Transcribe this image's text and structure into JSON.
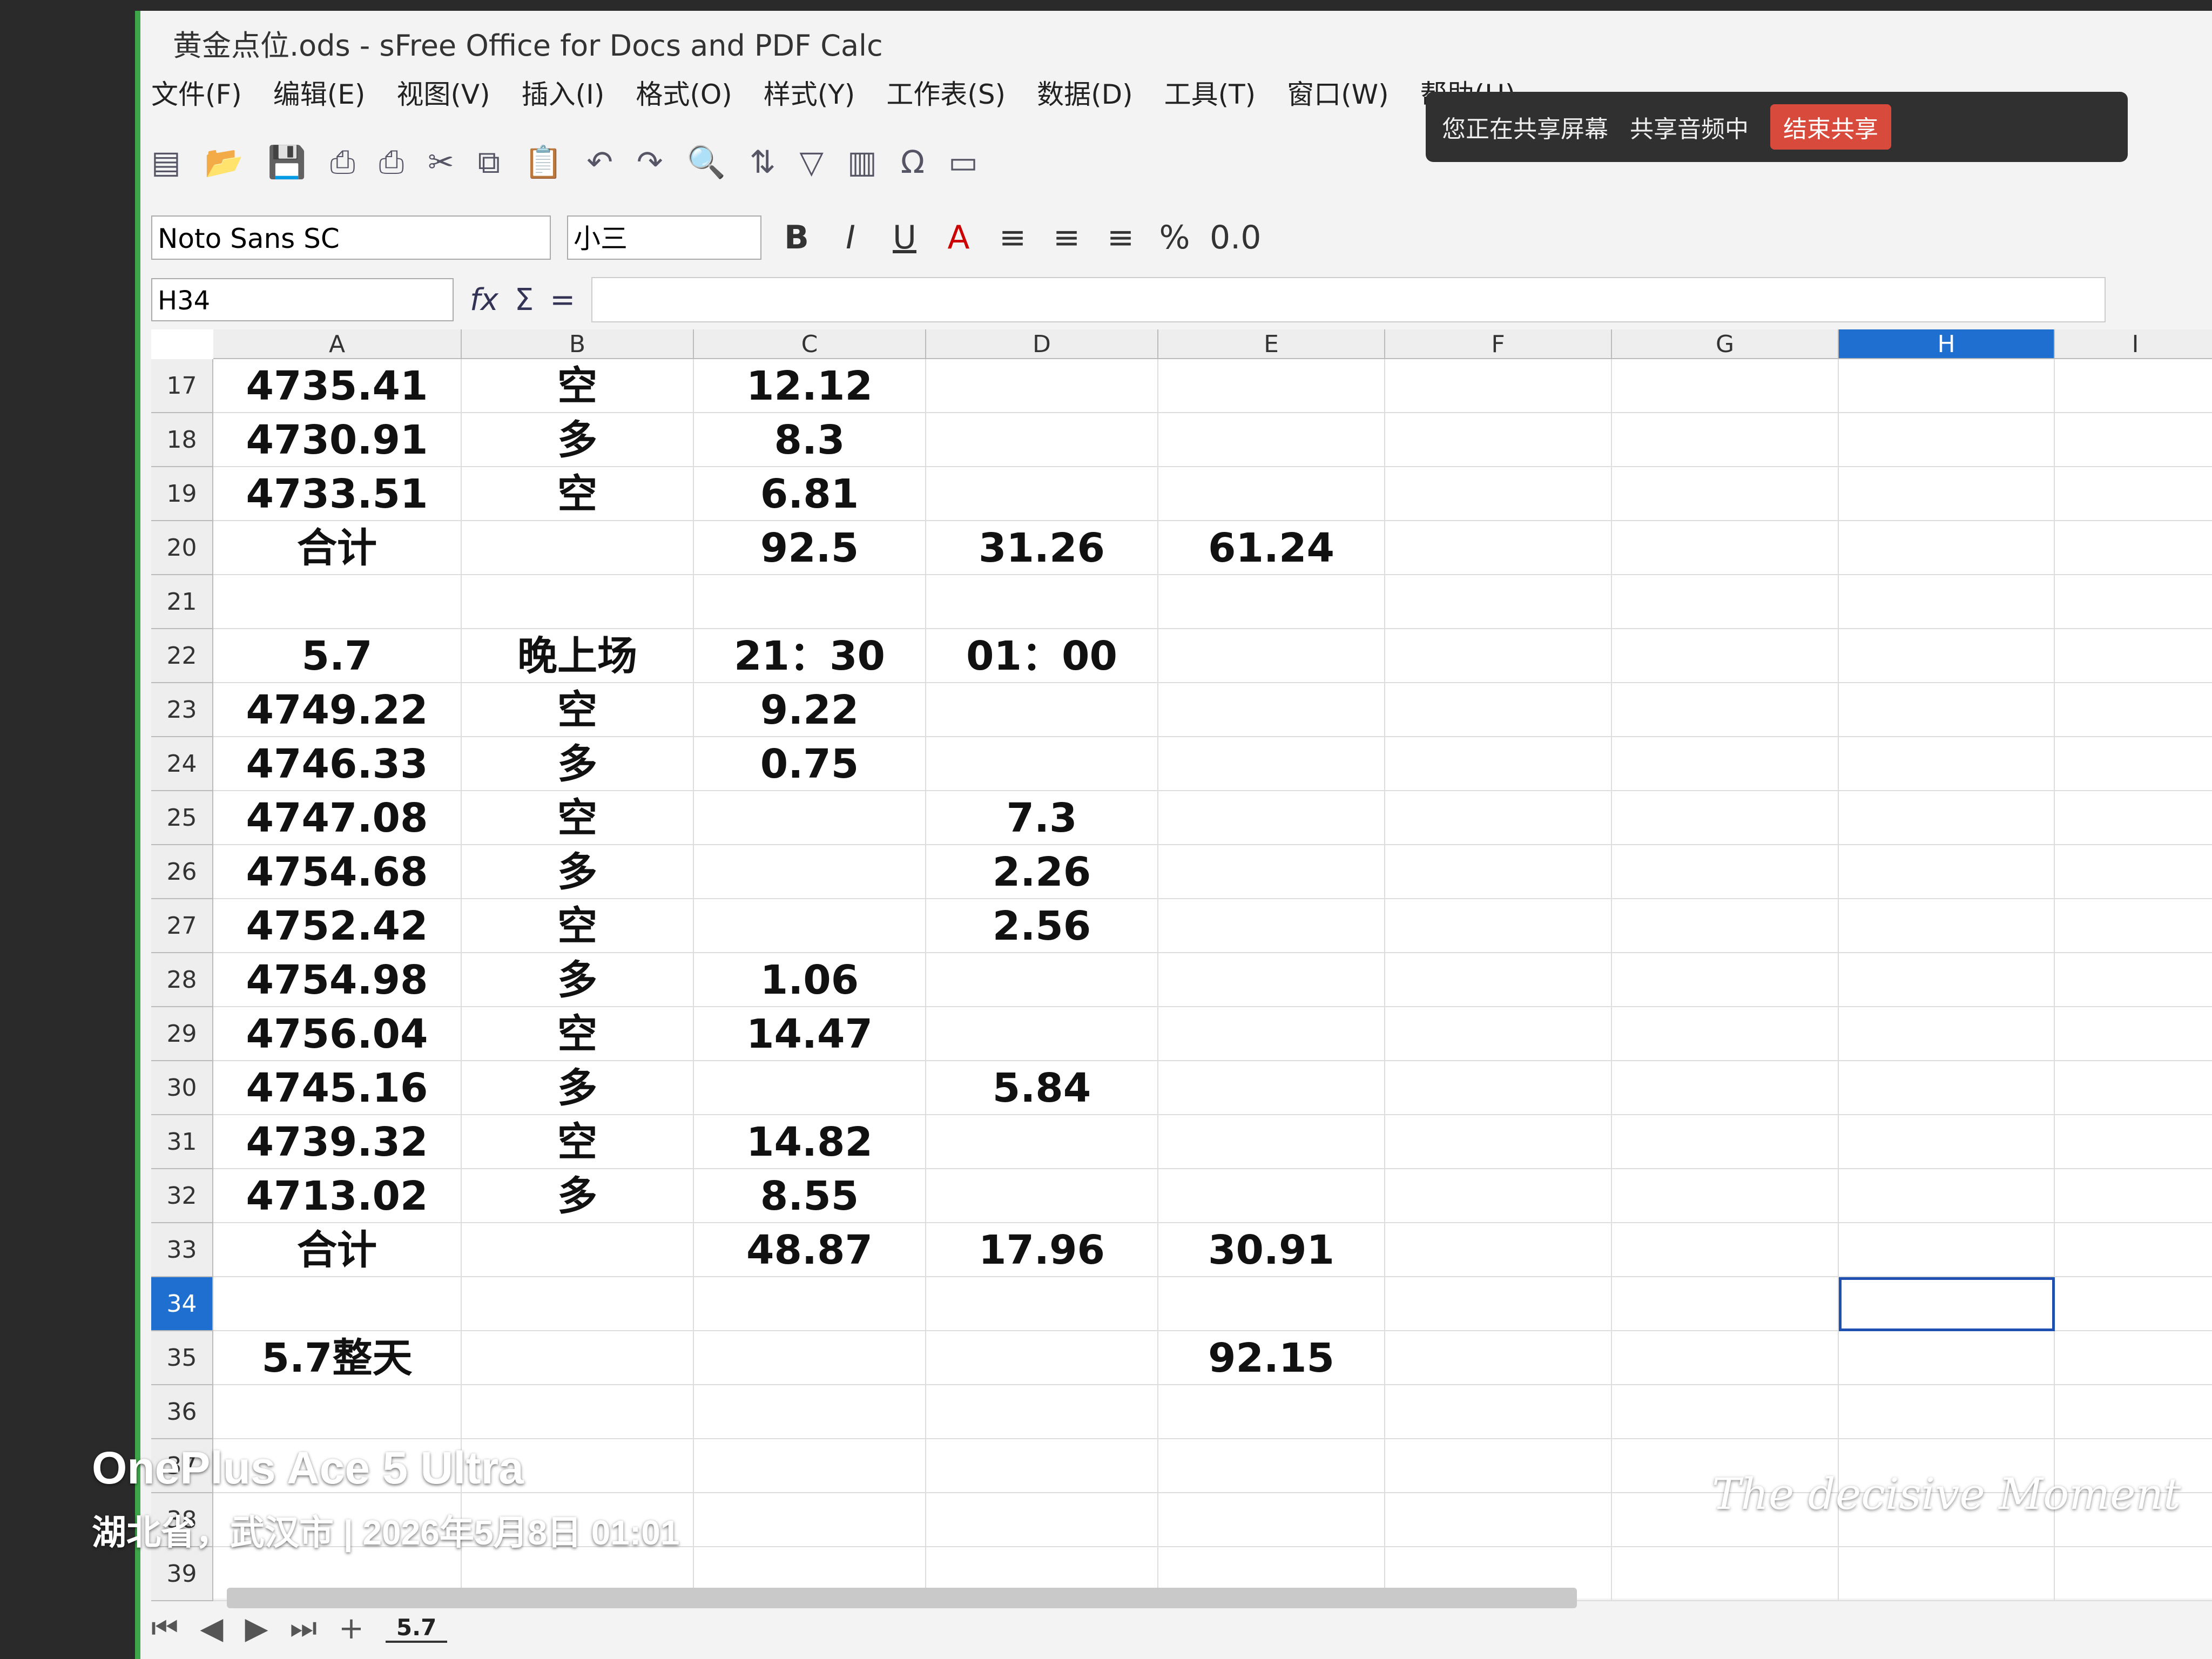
{
  "window": {
    "title": "黄金点位.ods - sFree Office for Docs and PDF Calc"
  },
  "menu": [
    "文件(F)",
    "编辑(E)",
    "视图(V)",
    "插入(I)",
    "格式(O)",
    "样式(Y)",
    "工作表(S)",
    "数据(D)",
    "工具(T)",
    "窗口(W)",
    "帮助(H)"
  ],
  "share_bar": {
    "status": "您正在共享屏幕",
    "audio": "共享音频中",
    "end_button": "结束共享"
  },
  "format_bar": {
    "font": "Noto Sans SC",
    "size": "小三",
    "bold": "B",
    "italic": "I",
    "underline": "U",
    "font_color": "A",
    "percent": "%",
    "decimal": "0.0"
  },
  "formula_bar": {
    "cell_ref": "H34",
    "fx": "fx",
    "sum": "Σ",
    "equals": "="
  },
  "columns": [
    "A",
    "B",
    "C",
    "D",
    "E",
    "F",
    "G",
    "H",
    "I"
  ],
  "selected_column": "H",
  "selected_row": "34",
  "rows": [
    {
      "n": "17",
      "A": "4735.41",
      "B": "空",
      "C": "12.12",
      "D": "",
      "E": ""
    },
    {
      "n": "18",
      "A": "4730.91",
      "B": "多",
      "C": "8.3",
      "D": "",
      "E": ""
    },
    {
      "n": "19",
      "A": "4733.51",
      "B": "空",
      "C": "6.81",
      "D": "",
      "E": ""
    },
    {
      "n": "20",
      "A": "合计",
      "B": "",
      "C": "92.5",
      "D": "31.26",
      "E": "61.24"
    },
    {
      "n": "21",
      "A": "",
      "B": "",
      "C": "",
      "D": "",
      "E": ""
    },
    {
      "n": "22",
      "A": "5.7",
      "B": "晚上场",
      "C": "21：30",
      "D": "01：00",
      "E": ""
    },
    {
      "n": "23",
      "A": "4749.22",
      "B": "空",
      "C": "9.22",
      "D": "",
      "E": ""
    },
    {
      "n": "24",
      "A": "4746.33",
      "B": "多",
      "C": "0.75",
      "D": "",
      "E": ""
    },
    {
      "n": "25",
      "A": "4747.08",
      "B": "空",
      "C": "",
      "D": "7.3",
      "E": ""
    },
    {
      "n": "26",
      "A": "4754.68",
      "B": "多",
      "C": "",
      "D": "2.26",
      "E": ""
    },
    {
      "n": "27",
      "A": "4752.42",
      "B": "空",
      "C": "",
      "D": "2.56",
      "E": ""
    },
    {
      "n": "28",
      "A": "4754.98",
      "B": "多",
      "C": "1.06",
      "D": "",
      "E": ""
    },
    {
      "n": "29",
      "A": "4756.04",
      "B": "空",
      "C": "14.47",
      "D": "",
      "E": ""
    },
    {
      "n": "30",
      "A": "4745.16",
      "B": "多",
      "C": "",
      "D": "5.84",
      "E": ""
    },
    {
      "n": "31",
      "A": "4739.32",
      "B": "空",
      "C": "14.82",
      "D": "",
      "E": ""
    },
    {
      "n": "32",
      "A": "4713.02",
      "B": "多",
      "C": "8.55",
      "D": "",
      "E": ""
    },
    {
      "n": "33",
      "A": "合计",
      "B": "",
      "C": "48.87",
      "D": "17.96",
      "E": "30.91"
    },
    {
      "n": "34",
      "A": "",
      "B": "",
      "C": "",
      "D": "",
      "E": ""
    },
    {
      "n": "35",
      "A": "5.7整天",
      "B": "",
      "C": "",
      "D": "",
      "E": "92.15"
    },
    {
      "n": "36",
      "A": "",
      "B": "",
      "C": "",
      "D": "",
      "E": ""
    },
    {
      "n": "37",
      "A": "",
      "B": "",
      "C": "",
      "D": "",
      "E": ""
    },
    {
      "n": "38",
      "A": "",
      "B": "",
      "C": "",
      "D": "",
      "E": ""
    },
    {
      "n": "39",
      "A": "",
      "B": "",
      "C": "",
      "D": "",
      "E": ""
    }
  ],
  "sheet_tab": {
    "active": "5.7",
    "add": "+"
  },
  "watermark": {
    "device": "OnePlus Ace 5 Ultra",
    "location_time": "湖北省，武汉市 | 2026年5月8日 01:01",
    "signature": "The decisive Moment"
  }
}
